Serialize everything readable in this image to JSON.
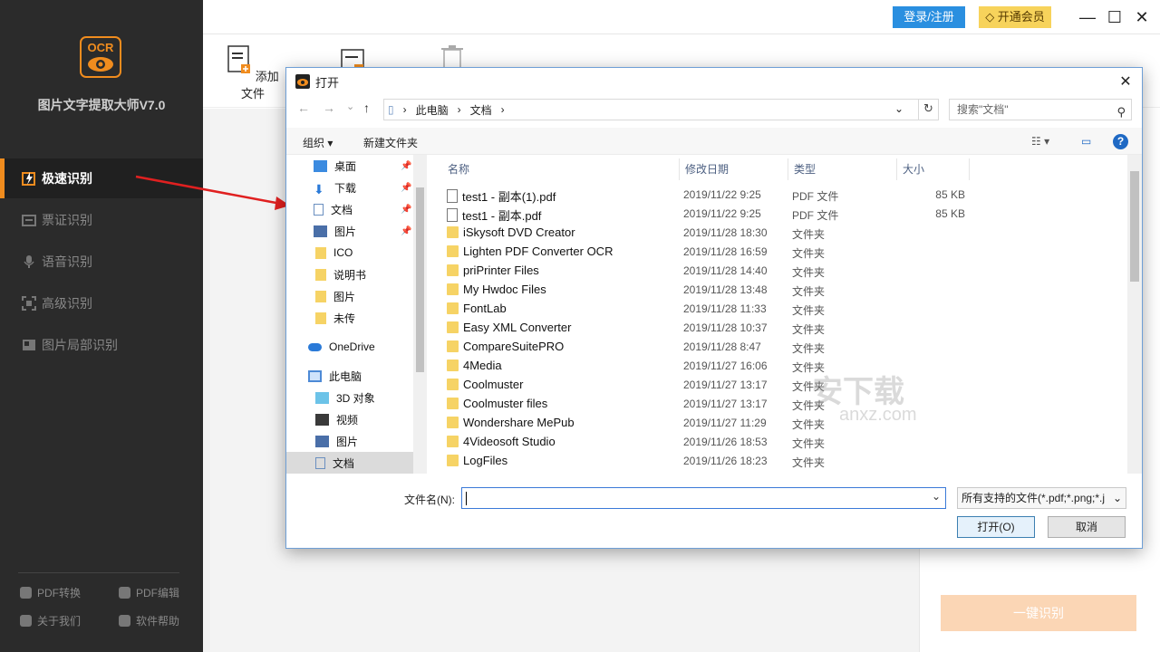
{
  "app": {
    "logo_text": "OCR",
    "title": "图片文字提取大师V7.0",
    "accent": "#f08c1e"
  },
  "sidebar": {
    "items": [
      {
        "label": "极速识别",
        "active": true,
        "icon": "lightning-icon"
      },
      {
        "label": "票证识别",
        "active": false,
        "icon": "ticket-icon"
      },
      {
        "label": "语音识别",
        "active": false,
        "icon": "microphone-icon"
      },
      {
        "label": "高级识别",
        "active": false,
        "icon": "scan-icon"
      },
      {
        "label": "图片局部识别",
        "active": false,
        "icon": "image-crop-icon"
      }
    ],
    "footer": [
      {
        "label": "PDF转换",
        "icon": "pdf-convert-icon"
      },
      {
        "label": "PDF编辑",
        "icon": "pdf-edit-icon"
      },
      {
        "label": "关于我们",
        "icon": "info-icon"
      },
      {
        "label": "软件帮助",
        "icon": "help-icon"
      }
    ]
  },
  "topbar": {
    "login_label": "登录/注册",
    "vip_label": "开通会员",
    "login_color": "#2a8fe0",
    "vip_color": "#f7d35b"
  },
  "toolbar": {
    "add_file_label": "添加文件"
  },
  "ocr_button_label": "一键识别",
  "dialog": {
    "title": "打开",
    "breadcrumb": [
      "此电脑",
      "文档"
    ],
    "search_placeholder": "搜索\"文档\"",
    "organize_label": "组织 ▾",
    "new_folder_label": "新建文件夹",
    "nav_tree": [
      {
        "label": "桌面",
        "icon": "desktop-icon",
        "pinned": true
      },
      {
        "label": "下载",
        "icon": "download-icon",
        "pinned": true
      },
      {
        "label": "文档",
        "icon": "document-icon",
        "pinned": true
      },
      {
        "label": "图片",
        "icon": "picture-icon",
        "pinned": true
      },
      {
        "label": "ICO",
        "icon": "folder-icon",
        "pinned": false
      },
      {
        "label": "说明书",
        "icon": "folder-icon",
        "pinned": false
      },
      {
        "label": "图片",
        "icon": "folder-icon",
        "pinned": false
      },
      {
        "label": "未传",
        "icon": "folder-icon",
        "pinned": false
      },
      {
        "label": "OneDrive",
        "icon": "cloud-icon",
        "pinned": false
      },
      {
        "label": "此电脑",
        "icon": "computer-icon",
        "pinned": false
      },
      {
        "label": "3D 对象",
        "icon": "cube-icon",
        "pinned": false
      },
      {
        "label": "视频",
        "icon": "video-icon",
        "pinned": false
      },
      {
        "label": "图片",
        "icon": "picture-icon",
        "pinned": false
      },
      {
        "label": "文档",
        "icon": "document-icon",
        "pinned": false,
        "selected": true
      }
    ],
    "columns": [
      "名称",
      "修改日期",
      "类型",
      "大小"
    ],
    "files": [
      {
        "name": "test1 - 副本(1).pdf",
        "date": "2019/11/22 9:25",
        "type": "PDF 文件",
        "size": "85 KB",
        "kind": "pdf"
      },
      {
        "name": "test1 - 副本.pdf",
        "date": "2019/11/22 9:25",
        "type": "PDF 文件",
        "size": "85 KB",
        "kind": "pdf"
      },
      {
        "name": "iSkysoft DVD Creator",
        "date": "2019/11/28 18:30",
        "type": "文件夹",
        "size": "",
        "kind": "folder"
      },
      {
        "name": "Lighten PDF Converter OCR",
        "date": "2019/11/28 16:59",
        "type": "文件夹",
        "size": "",
        "kind": "folder"
      },
      {
        "name": "priPrinter Files",
        "date": "2019/11/28 14:40",
        "type": "文件夹",
        "size": "",
        "kind": "folder"
      },
      {
        "name": "My Hwdoc Files",
        "date": "2019/11/28 13:48",
        "type": "文件夹",
        "size": "",
        "kind": "folder"
      },
      {
        "name": "FontLab",
        "date": "2019/11/28 11:33",
        "type": "文件夹",
        "size": "",
        "kind": "folder"
      },
      {
        "name": "Easy XML Converter",
        "date": "2019/11/28 10:37",
        "type": "文件夹",
        "size": "",
        "kind": "folder"
      },
      {
        "name": "CompareSuitePRO",
        "date": "2019/11/28 8:47",
        "type": "文件夹",
        "size": "",
        "kind": "folder"
      },
      {
        "name": "4Media",
        "date": "2019/11/27 16:06",
        "type": "文件夹",
        "size": "",
        "kind": "folder"
      },
      {
        "name": "Coolmuster",
        "date": "2019/11/27 13:17",
        "type": "文件夹",
        "size": "",
        "kind": "folder"
      },
      {
        "name": "Coolmuster files",
        "date": "2019/11/27 13:17",
        "type": "文件夹",
        "size": "",
        "kind": "folder"
      },
      {
        "name": "Wondershare MePub",
        "date": "2019/11/27 11:29",
        "type": "文件夹",
        "size": "",
        "kind": "folder"
      },
      {
        "name": "4Videosoft Studio",
        "date": "2019/11/26 18:53",
        "type": "文件夹",
        "size": "",
        "kind": "folder"
      },
      {
        "name": "LogFiles",
        "date": "2019/11/26 18:23",
        "type": "文件夹",
        "size": "",
        "kind": "folder"
      }
    ],
    "filename_label": "文件名(N):",
    "filename_value": "",
    "filter_label": "所有支持的文件(*.pdf;*.png;*.j",
    "open_label": "打开(O)",
    "cancel_label": "取消"
  },
  "watermark": {
    "text": "安下载",
    "sub": "anxz.com"
  }
}
